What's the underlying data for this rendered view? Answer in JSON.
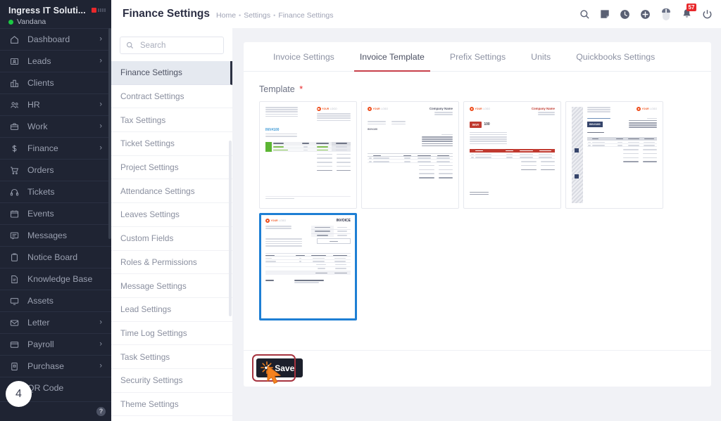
{
  "sidebar": {
    "org_name": "Ingress IT Soluti...",
    "user_name": "Vandana",
    "items": [
      {
        "label": "Dashboard",
        "icon": "home-icon",
        "chevron": true
      },
      {
        "label": "Leads",
        "icon": "leads-icon",
        "chevron": true
      },
      {
        "label": "Clients",
        "icon": "clients-icon",
        "chevron": false
      },
      {
        "label": "HR",
        "icon": "hr-icon",
        "chevron": true
      },
      {
        "label": "Work",
        "icon": "work-briefcase-icon",
        "chevron": true
      },
      {
        "label": "Finance",
        "icon": "dollar-icon",
        "chevron": true
      },
      {
        "label": "Orders",
        "icon": "cart-icon",
        "chevron": false
      },
      {
        "label": "Tickets",
        "icon": "headset-icon",
        "chevron": false
      },
      {
        "label": "Events",
        "icon": "calendar-icon",
        "chevron": false
      },
      {
        "label": "Messages",
        "icon": "chat-icon",
        "chevron": false
      },
      {
        "label": "Notice Board",
        "icon": "clipboard-icon",
        "chevron": false
      },
      {
        "label": "Knowledge Base",
        "icon": "document-icon",
        "chevron": false
      },
      {
        "label": "Assets",
        "icon": "monitor-icon",
        "chevron": false
      },
      {
        "label": "Letter",
        "icon": "envelope-icon",
        "chevron": true
      },
      {
        "label": "Payroll",
        "icon": "wallet-icon",
        "chevron": true
      },
      {
        "label": "Purchase",
        "icon": "purchase-icon",
        "chevron": true
      },
      {
        "label": "QR Code",
        "icon": "qr-code-icon",
        "chevron": false
      }
    ],
    "help_label": "?"
  },
  "header": {
    "title": "Finance Settings",
    "breadcrumb": [
      "Home",
      "Settings",
      "Finance Settings"
    ],
    "actions": [
      {
        "icon": "search-icon"
      },
      {
        "icon": "note-icon"
      },
      {
        "icon": "clock-icon"
      },
      {
        "icon": "plus-circle-icon"
      },
      {
        "icon": "mouse-icon"
      },
      {
        "icon": "bell-icon"
      },
      {
        "icon": "power-icon"
      }
    ],
    "notification_count": "57"
  },
  "settings_panel": {
    "search": {
      "value": "",
      "placeholder": "Search"
    },
    "items": [
      {
        "label": "Finance Settings",
        "active": true
      },
      {
        "label": "Contract Settings",
        "active": false
      },
      {
        "label": "Tax Settings",
        "active": false
      },
      {
        "label": "Ticket Settings",
        "active": false
      },
      {
        "label": "Project Settings",
        "active": false
      },
      {
        "label": "Attendance Settings",
        "active": false
      },
      {
        "label": "Leaves Settings",
        "active": false
      },
      {
        "label": "Custom Fields",
        "active": false
      },
      {
        "label": "Roles & Permissions",
        "active": false
      },
      {
        "label": "Message Settings",
        "active": false
      },
      {
        "label": "Lead Settings",
        "active": false
      },
      {
        "label": "Time Log Settings",
        "active": false
      },
      {
        "label": "Task Settings",
        "active": false
      },
      {
        "label": "Security Settings",
        "active": false
      },
      {
        "label": "Theme Settings",
        "active": false
      }
    ]
  },
  "main": {
    "tabs": [
      {
        "label": "Invoice Settings",
        "active": false
      },
      {
        "label": "Invoice Template",
        "active": true
      },
      {
        "label": "Prefix Settings",
        "active": false
      },
      {
        "label": "Units",
        "active": false
      },
      {
        "label": "Quickbooks Settings",
        "active": false
      }
    ],
    "template_field_label": "Template",
    "template_required_mark": "*",
    "templates": [
      {
        "name": "template-1-green",
        "selected": false,
        "accent": "#5cb533",
        "invoice_no": "INV#100",
        "invoice_no_color": "#3f9ad6",
        "logo_text": "YOUR",
        "logo_text2": "LOGO"
      },
      {
        "name": "template-2-plain",
        "selected": false,
        "accent": "#9ba0ae",
        "company_name": "Company Name",
        "invoice_no": "INV#100",
        "logo_text": "YOUR",
        "logo_text2": "LOGO"
      },
      {
        "name": "template-3-red",
        "selected": false,
        "accent": "#c0392f",
        "company_name": "Company Name",
        "invoice_no": "INV# 100",
        "logo_text": "YOUR",
        "logo_text2": "LOGO"
      },
      {
        "name": "template-4-striped",
        "selected": false,
        "accent": "#36456b",
        "invoice_no": "INV#100",
        "logo_text": "YOUR",
        "logo_text2": "LOGO"
      },
      {
        "name": "template-5-blue-selected",
        "selected": true,
        "accent": "#1e7fd4",
        "invoice_title": "INVOICE",
        "logo_text": "YOUR",
        "logo_text2": "LOGO"
      }
    ],
    "save_label": "Save",
    "save_check_glyph": "✔"
  },
  "annotation": {
    "step_number": "4",
    "click_highlight_color": "#a6333f",
    "cursor_color": "#f5821f"
  },
  "colors": {
    "sidebar_bg": "#1f2433",
    "page_bg": "#f1f2f6",
    "accent_red": "#e8282b",
    "tab_active_underline": "#c8404a",
    "selected_border": "#1e7fd4",
    "save_bg": "#1c1f2b"
  }
}
